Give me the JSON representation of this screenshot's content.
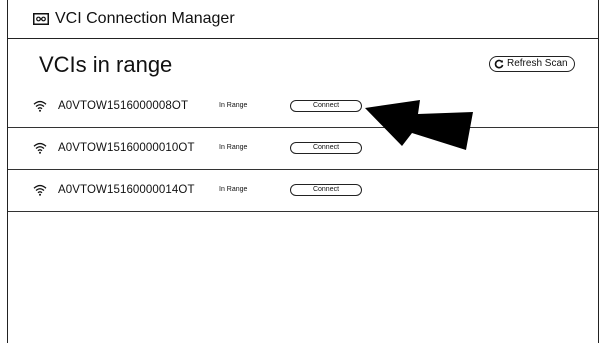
{
  "window": {
    "title": "VCI Connection Manager",
    "icon": "link-icon"
  },
  "main": {
    "heading": "VCIs in range",
    "refresh_label": "Refresh Scan",
    "vcis": [
      {
        "name": "A0VTOW1516000008OT",
        "status": "In Range",
        "connect_label": "Connect"
      },
      {
        "name": "A0VTOW15160000010OT",
        "status": "In Range",
        "connect_label": "Connect"
      },
      {
        "name": "A0VTOW15160000014OT",
        "status": "In Range",
        "connect_label": "Connect"
      }
    ]
  },
  "annotation": {
    "type": "arrow",
    "color": "#000000",
    "points_to": "first Connect button"
  }
}
